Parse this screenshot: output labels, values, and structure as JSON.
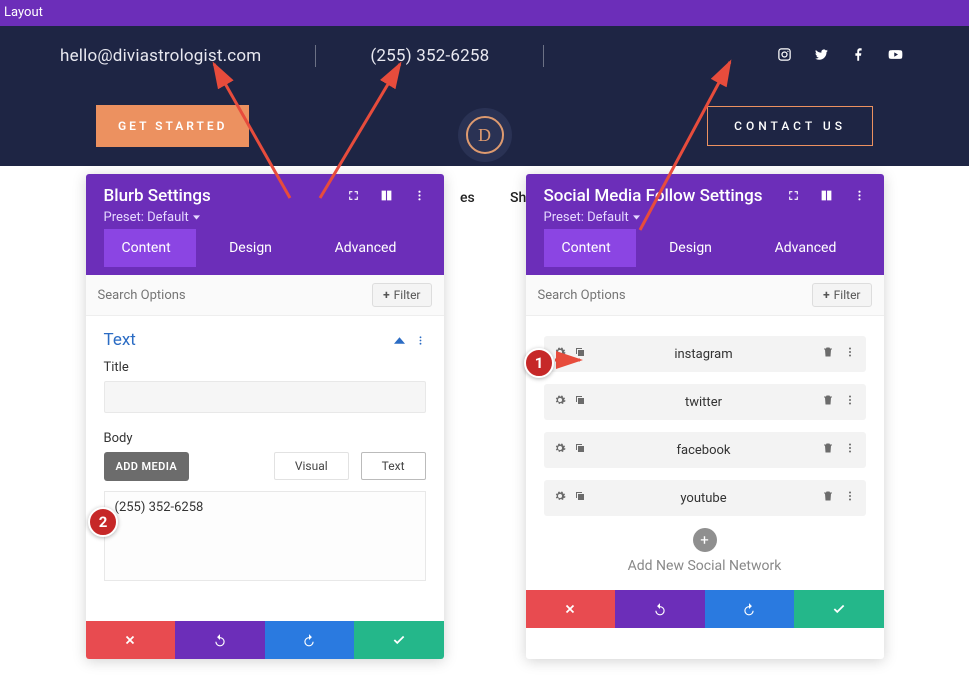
{
  "page": {
    "layout_label": "Layout"
  },
  "header": {
    "email": "hello@diviastrologist.com",
    "phone": "(255) 352-6258",
    "get_started_label": "GET STARTED",
    "contact_us_label": "CONTACT US",
    "logo_letter": "D",
    "behind_text_1": "es",
    "behind_text_2": "Sho"
  },
  "panel_blurb": {
    "title": "Blurb Settings",
    "preset": "Preset: Default",
    "tabs": {
      "content": "Content",
      "design": "Design",
      "advanced": "Advanced"
    },
    "search_placeholder": "Search Options",
    "filter_label": "Filter",
    "section_label": "Text",
    "field_title_label": "Title",
    "field_title_value": "",
    "field_body_label": "Body",
    "add_media_label": "ADD MEDIA",
    "body_tab_visual": "Visual",
    "body_tab_text": "Text",
    "body_value": "(255) 352-6258"
  },
  "panel_social": {
    "title": "Social Media Follow Settings",
    "preset": "Preset: Default",
    "tabs": {
      "content": "Content",
      "design": "Design",
      "advanced": "Advanced"
    },
    "search_placeholder": "Search Options",
    "filter_label": "Filter",
    "items": [
      {
        "name": "instagram"
      },
      {
        "name": "twitter"
      },
      {
        "name": "facebook"
      },
      {
        "name": "youtube"
      }
    ],
    "add_new_label": "Add New Social Network"
  },
  "annotations": {
    "badge1": "1",
    "badge2": "2"
  }
}
